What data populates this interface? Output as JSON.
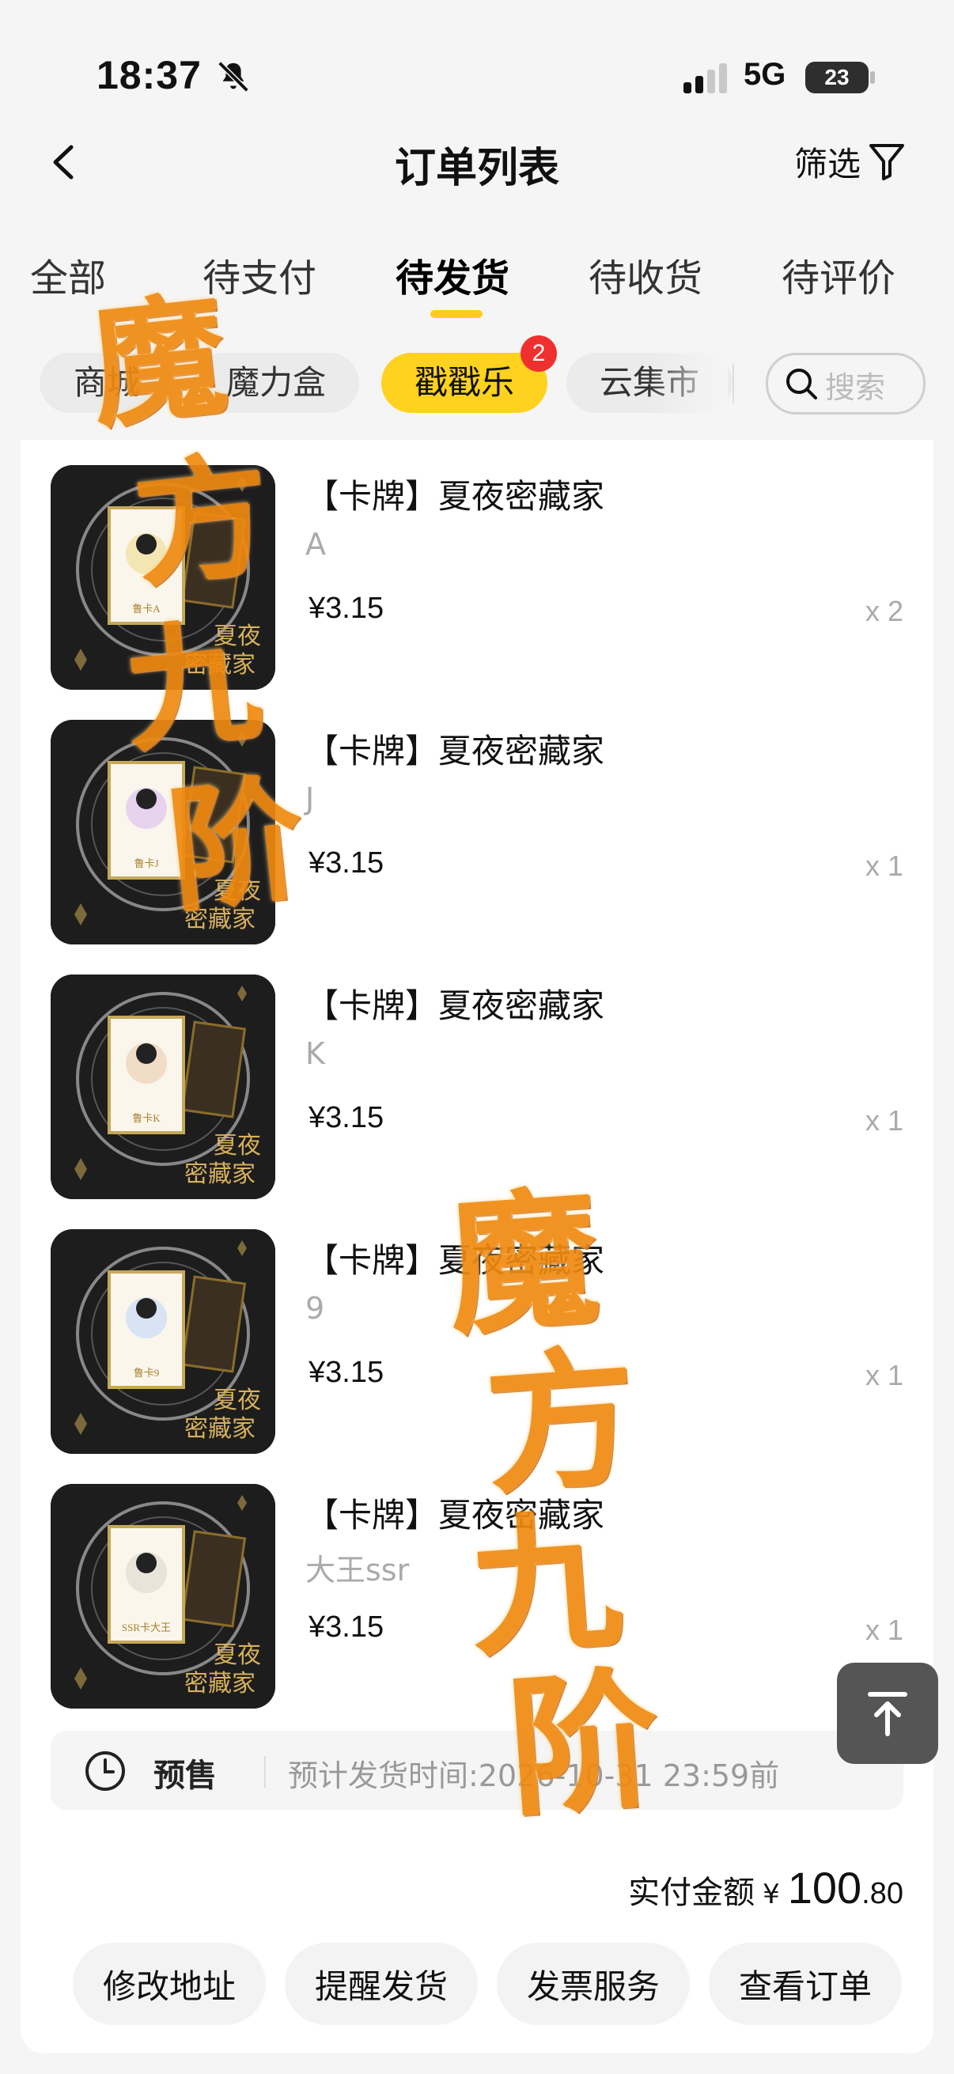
{
  "status_bar": {
    "time": "18:37",
    "network": "5G",
    "battery": "23"
  },
  "nav": {
    "title": "订单列表",
    "filter_label": "筛选"
  },
  "tabs": [
    {
      "label": "全部"
    },
    {
      "label": "待支付"
    },
    {
      "label": "待发货",
      "active": true
    },
    {
      "label": "待收货"
    },
    {
      "label": "待评价"
    }
  ],
  "chips": [
    {
      "label": "商城"
    },
    {
      "label": "魔力盒"
    },
    {
      "label": "戳戳乐",
      "active": true,
      "badge": "2"
    },
    {
      "label": "云集市"
    }
  ],
  "search": {
    "placeholder": "搜索"
  },
  "order": {
    "items": [
      {
        "title": "【卡牌】夏夜密藏家",
        "sku": "A",
        "price": "¥3.15",
        "qty": "x 2",
        "card_caption": "鲁卡A"
      },
      {
        "title": "【卡牌】夏夜密藏家",
        "sku": "J",
        "price": "¥3.15",
        "qty": "x 1",
        "card_caption": "鲁卡J"
      },
      {
        "title": "【卡牌】夏夜密藏家",
        "sku": "K",
        "price": "¥3.15",
        "qty": "x 1",
        "card_caption": "鲁卡K"
      },
      {
        "title": "【卡牌】夏夜密藏家",
        "sku": "9",
        "price": "¥3.15",
        "qty": "x 1",
        "card_caption": "鲁卡9"
      },
      {
        "title": "【卡牌】夏夜密藏家",
        "sku": "大王ssr",
        "price": "¥3.15",
        "qty": "x 1",
        "card_caption": "SSR卡大王"
      }
    ],
    "thumb_brand": "夏夜密藏家",
    "presale": {
      "label": "预售",
      "text": "预计发货时间:2026-10-31 23:59前"
    },
    "total": {
      "label": "实付金额",
      "currency": "¥",
      "integer": "100",
      "decimal": ".80"
    },
    "actions": [
      {
        "label": "修改地址"
      },
      {
        "label": "提醒发货"
      },
      {
        "label": "发票服务"
      },
      {
        "label": "查看订单"
      }
    ]
  },
  "watermark": {
    "text": "魔方九阶"
  },
  "colors": {
    "accent_yellow": "#ffd21f",
    "badge_red": "#f0302e",
    "watermark_orange": "#f08a10"
  }
}
